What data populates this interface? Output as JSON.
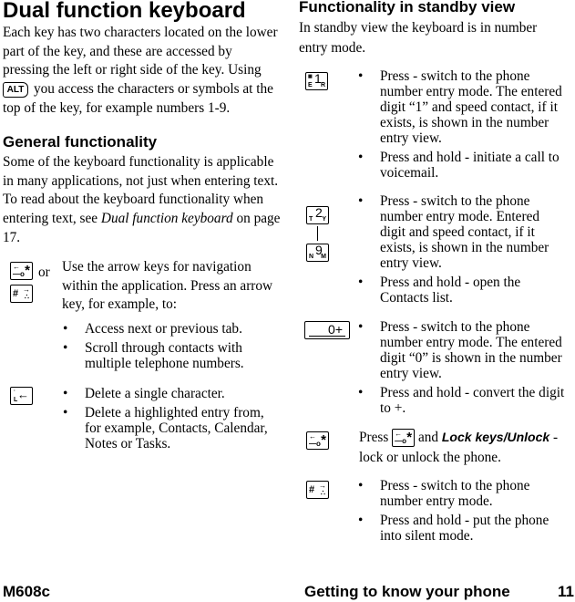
{
  "left": {
    "title": "Dual function keyboard",
    "intro_part1": "Each key has two characters located on the lower part of the key, and these are accessed by pressing the left or right side of the key. Using",
    "intro_part2": "you access the characters or symbols at the top of the key, for example numbers 1-9.",
    "alt_key_label": "ALT",
    "general": {
      "heading": "General functionality",
      "text_part1": "Some of the keyboard functionality is applicable in many applications, not just when entering text. To read about the keyboard functionality when entering text, see",
      "link_text": "Dual function keyboard",
      "text_part2": "on page 17."
    },
    "arrow_keys": {
      "or_label": "or",
      "description": "Use the arrow keys for navigation within the application. Press an arrow key, for example, to:",
      "bullets": [
        "Access next or previous tab.",
        "Scroll through contacts with multiple telephone numbers."
      ]
    },
    "back_key": {
      "bullets": [
        "Delete a single character.",
        "Delete a highlighted entry from, for example, Contacts, Calendar, Notes or Tasks."
      ]
    }
  },
  "right": {
    "heading": "Functionality in standby view",
    "intro": "In standby view the keyboard is in number entry mode.",
    "key1": {
      "digit": "1",
      "letters": [
        "E",
        "R"
      ],
      "bullets": [
        "Press - switch to the phone number entry mode. The entered digit “1” and speed contact, if it exists, is shown in the number entry view.",
        "Press and hold - initiate a call to voicemail."
      ]
    },
    "key2to9": {
      "key_start": {
        "digit": "2",
        "letters": [
          "T",
          "Y"
        ]
      },
      "key_end": {
        "digit": "9",
        "letters": [
          "N",
          "M"
        ]
      },
      "bullets": [
        "Press - switch to the phone number entry mode. Entered digit and speed contact, if it exists, is shown in the number entry view.",
        "Press and hold - open the Contacts list."
      ]
    },
    "key0": {
      "label": "0+",
      "bullets": [
        "Press - switch to the phone number entry mode. The entered digit “0” is shown in the number entry view.",
        "Press and hold - convert the digit to +."
      ]
    },
    "lock": {
      "press": "Press",
      "and": "and",
      "command": "Lock keys/Unlock",
      "rest": "- lock or unlock the phone."
    },
    "hash_key": {
      "bullets": [
        "Press - switch to the phone number entry mode.",
        "Press and hold - put the phone into silent mode."
      ]
    }
  },
  "footer": {
    "model": "M608c",
    "section": "Getting to know your phone",
    "page_number": "11"
  },
  "bullet_char": "•"
}
